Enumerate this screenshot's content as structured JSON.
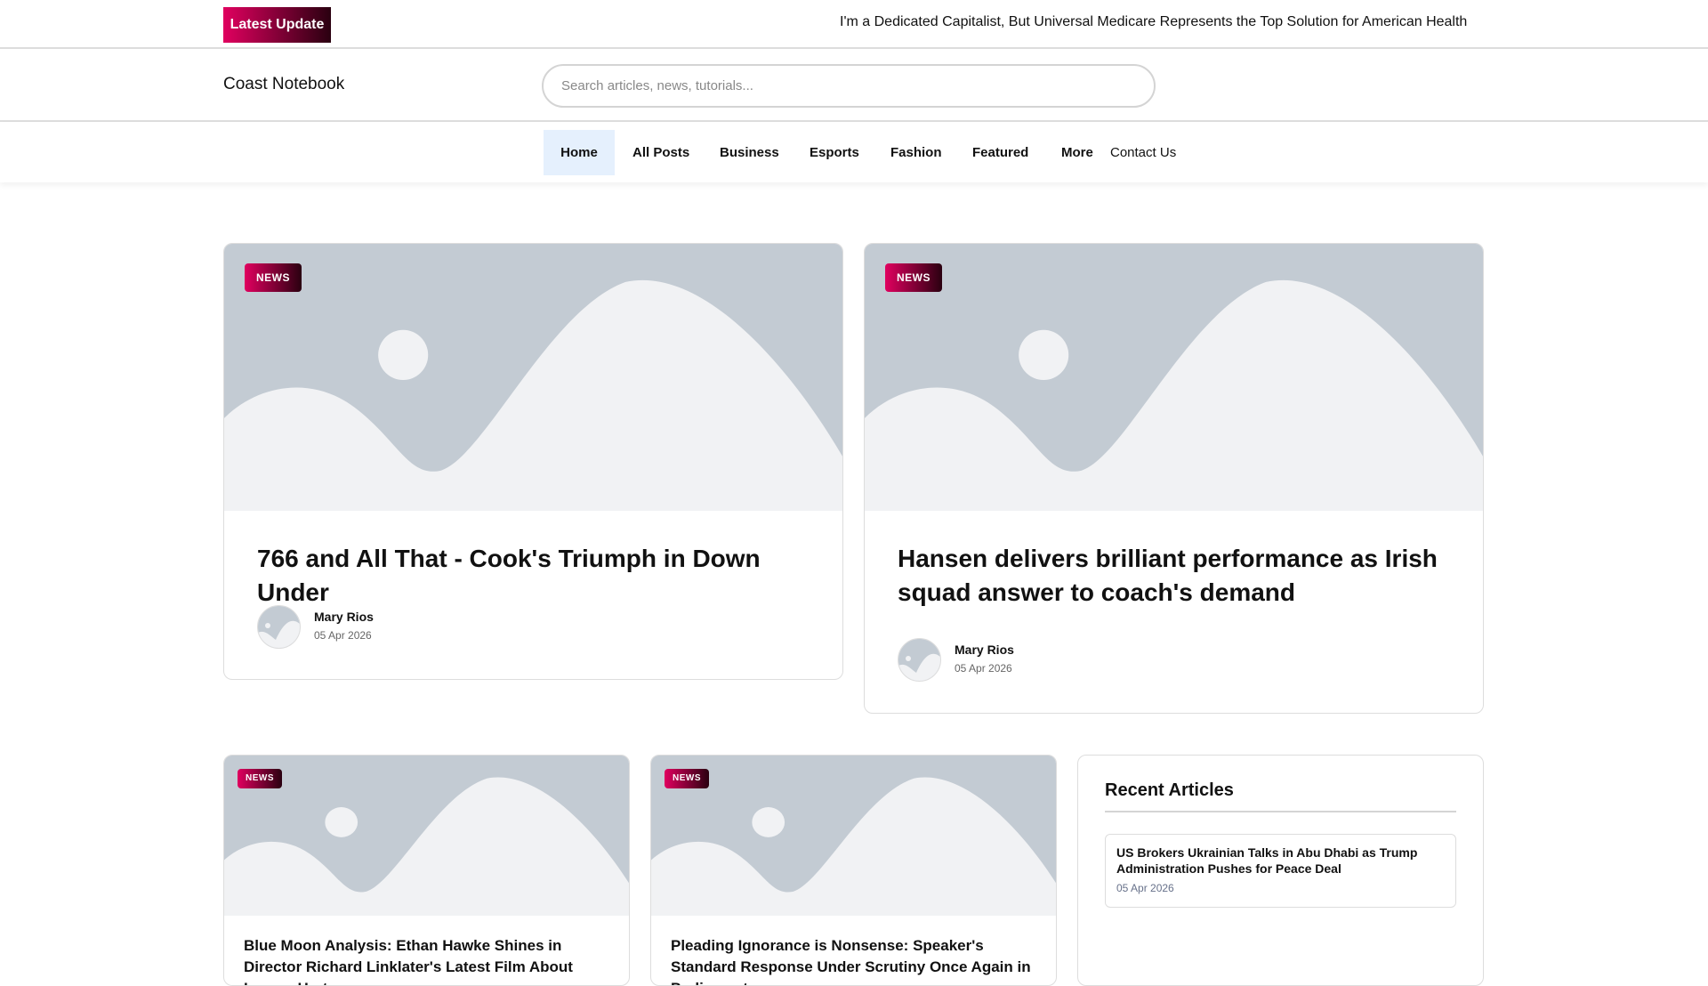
{
  "topbar": {
    "latest_label": "Latest Update",
    "ticker": "I'm a Dedicated Capitalist, But Universal Medicare Represents the Top Solution for American Health"
  },
  "header": {
    "logo": "Coast Notebook",
    "search_placeholder": "Search articles, news, tutorials..."
  },
  "nav": {
    "items": [
      {
        "label": "Home"
      },
      {
        "label": "All Posts"
      },
      {
        "label": "Business"
      },
      {
        "label": "Esports"
      },
      {
        "label": "Fashion"
      },
      {
        "label": "Featured"
      },
      {
        "label": "More"
      },
      {
        "label": "Contact Us"
      }
    ]
  },
  "featured": [
    {
      "badge": "NEWS",
      "title": "766 and All That - Cook's Triumph in Down Under",
      "author": "Mary Rios",
      "date": "05 Apr 2026"
    },
    {
      "badge": "NEWS",
      "title": "Hansen delivers brilliant performance as Irish squad answer to coach's demand",
      "author": "Mary Rios",
      "date": "05 Apr 2026"
    }
  ],
  "posts": [
    {
      "badge": "NEWS",
      "title": "Blue Moon Analysis: Ethan Hawke Shines in Director Richard Linklater's Latest Film About Lorenz Hart"
    },
    {
      "badge": "NEWS",
      "title": "Pleading Ignorance is Nonsense: Speaker's Standard Response Under Scrutiny Once Again in Parliament"
    }
  ],
  "sidebar": {
    "heading": "Recent Articles",
    "items": [
      {
        "title": "US Brokers Ukrainian Talks in Abu Dhabi as Trump Administration Pushes for Peace Deal",
        "date": "05 Apr 2026"
      }
    ]
  }
}
